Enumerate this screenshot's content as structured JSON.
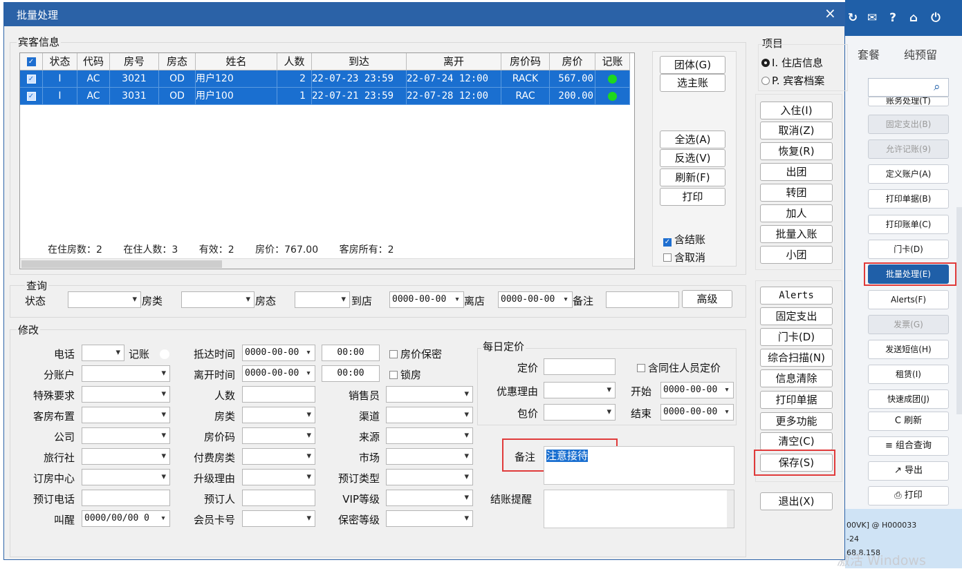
{
  "background_app": {
    "tabs": [
      "套餐",
      "纯预留"
    ],
    "side_buttons": [
      {
        "label": "账务处理(T)",
        "state": "partial"
      },
      {
        "label": "固定支出(B)",
        "state": "disabled"
      },
      {
        "label": "允许记账(9)",
        "state": "disabled"
      },
      {
        "label": "定义账户(A)",
        "state": "normal"
      },
      {
        "label": "打印单据(B)",
        "state": "normal"
      },
      {
        "label": "打印账单(C)",
        "state": "normal"
      },
      {
        "label": "门卡(D)",
        "state": "normal"
      },
      {
        "label": "批量处理(E)",
        "state": "highlight"
      },
      {
        "label": "Alerts(F)",
        "state": "normal"
      },
      {
        "label": "发票(G)",
        "state": "disabled"
      },
      {
        "label": "发送短信(H)",
        "state": "normal"
      },
      {
        "label": "租赁(I)",
        "state": "normal"
      },
      {
        "label": "快速成团(J)",
        "state": "normal"
      },
      {
        "label": "C 刷新",
        "state": "normal"
      },
      {
        "label": "≡ 组合查询",
        "state": "normal"
      },
      {
        "label": "↗ 导出",
        "state": "normal"
      },
      {
        "label": "⎙ 打印",
        "state": "normal"
      }
    ],
    "status_lines": [
      "00VK] @ H000033",
      "-24",
      "68.8.158"
    ],
    "watermark": "激活 Windows"
  },
  "dialog": {
    "title": "批量处理",
    "close": "×",
    "guest_section_label": "宾客信息",
    "grid": {
      "headers": [
        "",
        "状态",
        "代码",
        "房号",
        "房态",
        "姓名",
        "人数",
        "到达",
        "离开",
        "房价码",
        "房价",
        "记账"
      ],
      "rows": [
        [
          "",
          "I",
          "AC",
          "3021",
          "OD",
          "用户120",
          "2",
          "22-07-23 23:59",
          "22-07-24 12:00",
          "RACK",
          "567.00",
          ""
        ],
        [
          "",
          "I",
          "AC",
          "3031",
          "OD",
          "用户100",
          "1",
          "22-07-21 23:59",
          "22-07-28 12:00",
          "RAC",
          "200.00",
          ""
        ]
      ],
      "summary": [
        "在住房数：2",
        "在住人数：3",
        "有效：2",
        "房价：767.00",
        "客房所有：2"
      ]
    },
    "grid_buttons": {
      "group": "团体(G)",
      "main_account": "选主账",
      "select_all": "全选(A)",
      "invert": "反选(V)",
      "refresh": "刷新(F)",
      "print": "打印"
    },
    "grid_options": {
      "include_settled": "含结账",
      "include_cancelled": "含取消"
    },
    "query": {
      "label": "查询",
      "status": "状态",
      "room_type": "房类",
      "room_status": "房态",
      "arrive": "到店",
      "arrive_value": "0000-00-00",
      "depart": "离店",
      "depart_value": "0000-00-00",
      "remark": "备注",
      "advanced": "高级"
    },
    "modify": {
      "label": "修改",
      "phone": "电话",
      "charge": "记账",
      "sub_account": "分账户",
      "special_req": "特殊要求",
      "room_layout": "客房布置",
      "company": "公司",
      "agency": "旅行社",
      "booking_center": "订房中心",
      "booking_phone": "预订电话",
      "wakeup": "叫醒",
      "wakeup_value": "0000/00/00 0",
      "arrive_time": "抵达时间",
      "arrive_date": "0000-00-00",
      "arrive_hm": "00:00",
      "depart_time": "离开时间",
      "depart_date": "0000-00-00",
      "depart_hm": "00:00",
      "persons": "人数",
      "room_type": "房类",
      "rate_code": "房价码",
      "paid_room_type": "付费房类",
      "upgrade_reason": "升级理由",
      "booker": "预订人",
      "member_card": "会员卡号",
      "rate_secret": "房价保密",
      "lock_room": "锁房",
      "sales": "销售员",
      "channel": "渠道",
      "source": "来源",
      "market": "市场",
      "booking_type": "预订类型",
      "vip_level": "VIP等级",
      "secret_level": "保密等级"
    },
    "daily_rate": {
      "label": "每日定价",
      "price": "定价",
      "discount_reason": "优惠理由",
      "package": "包价",
      "include_cohabitant": "含同住人员定价",
      "start": "开始",
      "start_value": "0000-00-00",
      "end": "结束",
      "end_value": "0000-00-00"
    },
    "remark": {
      "label": "备注",
      "value": "注意接待",
      "checkout_reminder": "结账提醒"
    },
    "items": {
      "label": "项目",
      "option_in_house": "I. 住店信息",
      "option_profile": "P. 宾客档案",
      "buttons": [
        "入住(I)",
        "取消(Z)",
        "恢复(R)",
        "出团",
        "转团",
        "加人",
        "批量入账",
        "小团"
      ],
      "buttons2": [
        "Alerts",
        "固定支出",
        "门卡(D)",
        "综合扫描(N)",
        "信息清除",
        "打印单据",
        "更多功能",
        "清空(C)",
        "保存(S)"
      ],
      "exit": "退出(X)"
    }
  }
}
